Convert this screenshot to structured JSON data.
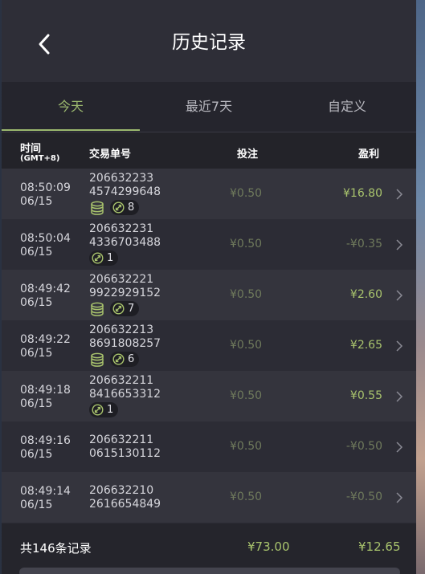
{
  "header": {
    "title": "历史记录",
    "back_icon": "chevron-left-icon"
  },
  "tabs": [
    {
      "label": "今天",
      "active": true
    },
    {
      "label": "最近7天",
      "active": false
    },
    {
      "label": "自定义",
      "active": false
    }
  ],
  "columns": {
    "time": "时间",
    "timezone": "(GMT+8)",
    "order": "交易单号",
    "bet": "投注",
    "profit": "盈利"
  },
  "records": [
    {
      "time": "08:50:09",
      "date": "06/15",
      "order_a": "206632233",
      "order_b": "4574299648",
      "coin": true,
      "chip_count": "8",
      "bet": "¥0.50",
      "profit": "¥16.80",
      "profit_type": "pos"
    },
    {
      "time": "08:50:04",
      "date": "06/15",
      "order_a": "206632231",
      "order_b": "4336703488",
      "coin": false,
      "chip_count": "1",
      "bet": "¥0.50",
      "profit": "-¥0.35",
      "profit_type": "neg"
    },
    {
      "time": "08:49:42",
      "date": "06/15",
      "order_a": "206632221",
      "order_b": "9922929152",
      "coin": true,
      "chip_count": "7",
      "bet": "¥0.50",
      "profit": "¥2.60",
      "profit_type": "pos"
    },
    {
      "time": "08:49:22",
      "date": "06/15",
      "order_a": "206632213",
      "order_b": "8691808257",
      "coin": true,
      "chip_count": "6",
      "bet": "¥0.50",
      "profit": "¥2.65",
      "profit_type": "pos"
    },
    {
      "time": "08:49:18",
      "date": "06/15",
      "order_a": "206632211",
      "order_b": "8416653312",
      "coin": false,
      "chip_count": "1",
      "bet": "¥0.50",
      "profit": "¥0.55",
      "profit_type": "pos"
    },
    {
      "time": "08:49:16",
      "date": "06/15",
      "order_a": "206632211",
      "order_b": "0615130112",
      "coin": false,
      "chip_count": null,
      "bet": "¥0.50",
      "profit": "-¥0.50",
      "profit_type": "neg"
    },
    {
      "time": "08:49:14",
      "date": "06/15",
      "order_a": "206632210",
      "order_b": "2616654849",
      "coin": false,
      "chip_count": null,
      "bet": "¥0.50",
      "profit": "-¥0.50",
      "profit_type": "neg"
    }
  ],
  "footer": {
    "total_label": "共146条记录",
    "total_bet": "¥73.00",
    "total_profit": "¥12.65"
  },
  "colors": {
    "accent": "#9bb86e",
    "positive": "#a9c46d",
    "muted": "#6f7a5c",
    "panel": "#2c2c35"
  }
}
